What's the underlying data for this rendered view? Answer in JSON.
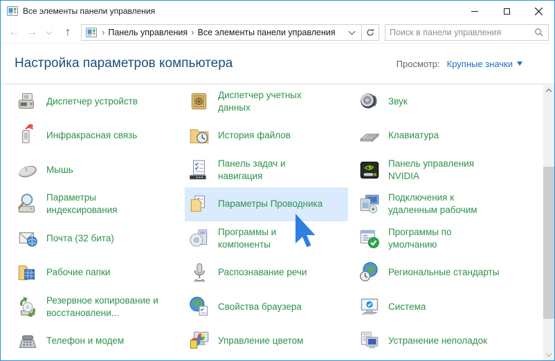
{
  "window": {
    "title": "Все элементы панели управления"
  },
  "toolbar": {
    "breadcrumb": [
      "Панель управления",
      "Все элементы панели управления"
    ],
    "search_placeholder": "Поиск в панели управления"
  },
  "header": {
    "title": "Настройка параметров компьютера",
    "view_label": "Просмотр:",
    "view_value": "Крупные значки"
  },
  "colors": {
    "item_link_green": "#2b9348",
    "header_blue": "#1d4e79",
    "view_link_blue": "#1d70c0",
    "selection_blue": "#d9ebfc",
    "window_border_blue": "#2a8ed5",
    "cursor_blue": "#2e7fe3"
  },
  "columns": [
    {
      "items": [
        {
          "label": "Диспетчер устройств",
          "icon": "device-manager-icon"
        },
        {
          "label": "Инфракрасная связь",
          "icon": "infrared-icon"
        },
        {
          "label": "Мышь",
          "icon": "mouse-icon"
        },
        {
          "label": "Параметры\nиндексирования",
          "icon": "indexing-options-icon"
        },
        {
          "label": "Почта (32 бита)",
          "icon": "mail-icon"
        },
        {
          "label": "Рабочие папки",
          "icon": "work-folders-icon"
        },
        {
          "label": "Резервное копирование и\nвосстановлени...",
          "icon": "backup-restore-icon"
        },
        {
          "label": "Телефон и модем",
          "icon": "phone-modem-icon"
        }
      ]
    },
    {
      "items": [
        {
          "label": "Диспетчер учетных\nданных",
          "icon": "credential-manager-icon"
        },
        {
          "label": "История файлов",
          "icon": "file-history-icon"
        },
        {
          "label": "Панель задач и\nнавигация",
          "icon": "taskbar-icon"
        },
        {
          "label": "Параметры Проводника",
          "icon": "folder-options-icon",
          "selected": true
        },
        {
          "label": "Программы и\nкомпоненты",
          "icon": "programs-features-icon"
        },
        {
          "label": "Распознавание речи",
          "icon": "speech-recognition-icon"
        },
        {
          "label": "Свойства браузера",
          "icon": "internet-options-icon"
        },
        {
          "label": "Управление цветом",
          "icon": "color-management-icon"
        }
      ]
    },
    {
      "items": [
        {
          "label": "Звук",
          "icon": "sound-icon"
        },
        {
          "label": "Клавиатура",
          "icon": "keyboard-icon"
        },
        {
          "label": "Панель управления\nNVIDIA",
          "icon": "nvidia-icon"
        },
        {
          "label": "Подключения к\nудаленным рабочим",
          "icon": "remote-desktop-icon"
        },
        {
          "label": "Программы по\nумолчанию",
          "icon": "default-programs-icon"
        },
        {
          "label": "Региональные стандарты",
          "icon": "region-icon"
        },
        {
          "label": "Система",
          "icon": "system-icon"
        },
        {
          "label": "Устранение неполадок",
          "icon": "troubleshooting-icon"
        }
      ]
    }
  ]
}
